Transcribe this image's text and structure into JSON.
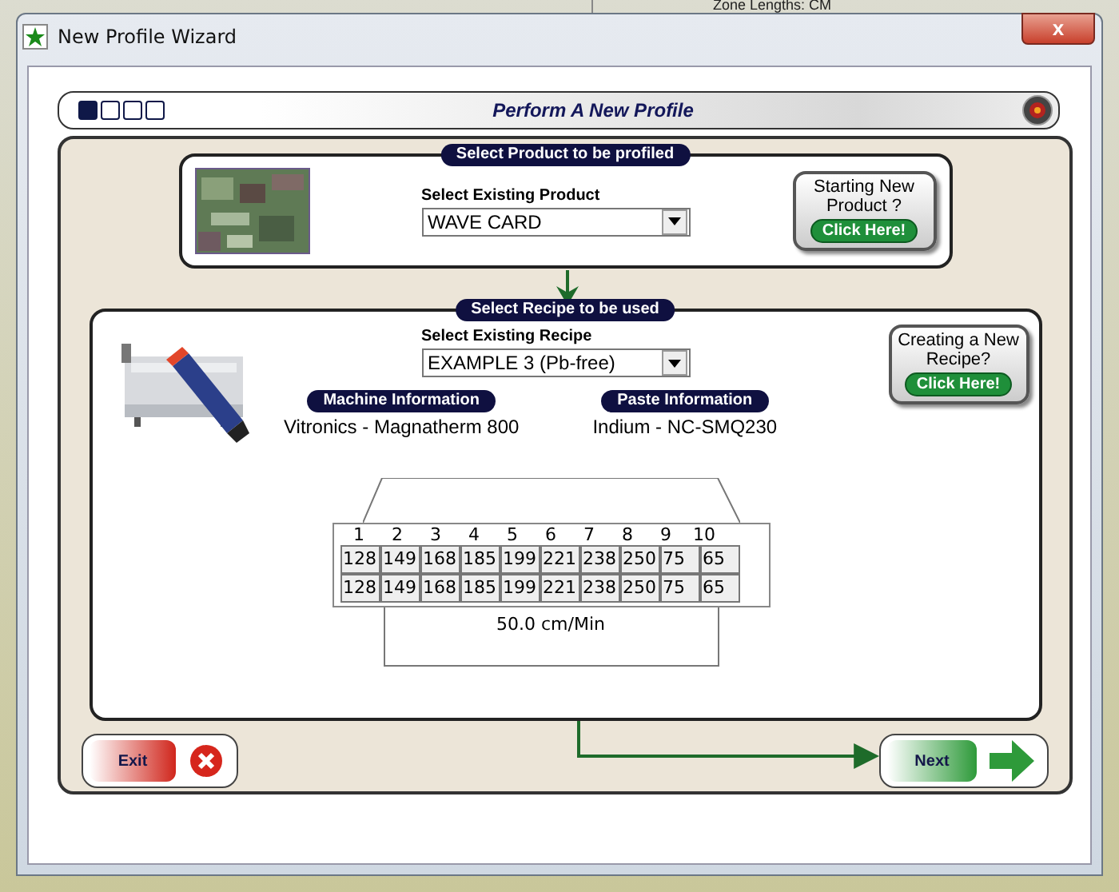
{
  "background_window": {
    "text": "Zone Lengths: CM"
  },
  "window": {
    "title": "New Profile Wizard",
    "close": "x"
  },
  "wizard": {
    "steps": [
      {
        "selected": true
      },
      {
        "selected": false
      },
      {
        "selected": false
      },
      {
        "selected": false
      }
    ],
    "title": "Perform A New Profile"
  },
  "product": {
    "heading": "Select Product to be profiled",
    "select_label": "Select Existing Product",
    "value": "WAVE CARD",
    "new_prompt": "Starting New Product ?",
    "new_button": "Click Here!"
  },
  "recipe": {
    "heading": "Select Recipe to be used",
    "select_label": "Select Existing Recipe",
    "value": "EXAMPLE 3 (Pb-free)",
    "new_prompt": "Creating a New Recipe?",
    "new_button": "Click Here!",
    "machine_label": "Machine Information",
    "machine": "Vitronics - Magnatherm 800",
    "paste_label": "Paste Information",
    "paste": "Indium - NC-SMQ230",
    "zones": [
      "1",
      "2",
      "3",
      "4",
      "5",
      "6",
      "7",
      "8",
      "9",
      "10"
    ],
    "rows": [
      [
        "128",
        "149",
        "168",
        "185",
        "199",
        "221",
        "238",
        "250",
        "75",
        "65"
      ],
      [
        "128",
        "149",
        "168",
        "185",
        "199",
        "221",
        "238",
        "250",
        "75",
        "65"
      ]
    ],
    "speed": "50.0 cm/Min"
  },
  "buttons": {
    "exit": "Exit",
    "next": "Next"
  }
}
